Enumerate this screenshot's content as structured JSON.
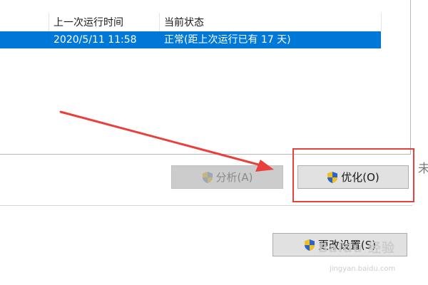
{
  "list": {
    "headers": [
      "上一次运行时间",
      "当前状态"
    ],
    "rows": [
      {
        "last_run": "2020/5/11 11:58",
        "status": "正常(距上次运行已有 17 天)",
        "selected": true
      }
    ]
  },
  "buttons": {
    "analyze": {
      "label": "分析(A)",
      "enabled": false,
      "icon": "uac-shield-icon"
    },
    "optimize": {
      "label": "优化(O)",
      "enabled": true,
      "icon": "uac-shield-icon"
    },
    "change_settings": {
      "label": "更改设置(S)",
      "enabled": true,
      "icon": "uac-shield-icon"
    }
  },
  "side_text": "未",
  "watermark": {
    "brand": "Baidu 经验",
    "url": "jingyan.baidu.com"
  },
  "colors": {
    "selection": "#0078d7",
    "annotation": "#e8413b",
    "button_face": "#e1e1e1",
    "button_disabled": "#cccccc"
  }
}
